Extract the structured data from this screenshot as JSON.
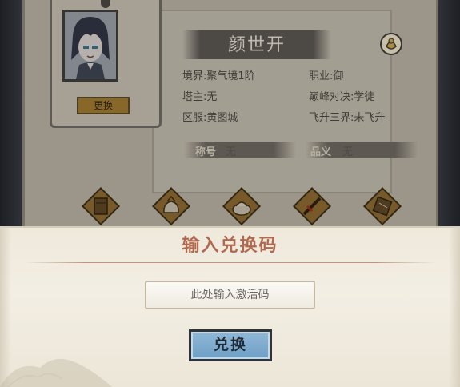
{
  "character": {
    "name": "颜世开",
    "swap_label": "更换",
    "realm": "境界:聚气境1阶",
    "profession": "职业:御",
    "tower_master": "塔主:无",
    "peak_duel": "巅峰对决:学徒",
    "server": "区服:黄图城",
    "ascension": "飞升三界:未飞升",
    "title_left_tag": "称号",
    "title_left_value": "无",
    "title_right_tag": "品义",
    "title_right_value": "无"
  },
  "equipment_slots": [
    {
      "icon": "scroll-icon"
    },
    {
      "icon": "pouch-icon"
    },
    {
      "icon": "pot-icon"
    },
    {
      "icon": "sword-icon"
    },
    {
      "icon": "book-icon"
    }
  ],
  "dialog": {
    "title": "输入兑换码",
    "input_placeholder": "此处输入激活码",
    "input_value": "",
    "redeem_label": "兑换"
  },
  "colors": {
    "dialog_title": "#b0694f",
    "redeem_button": "#7aa8cc",
    "swap_button": "#a07a2c"
  }
}
